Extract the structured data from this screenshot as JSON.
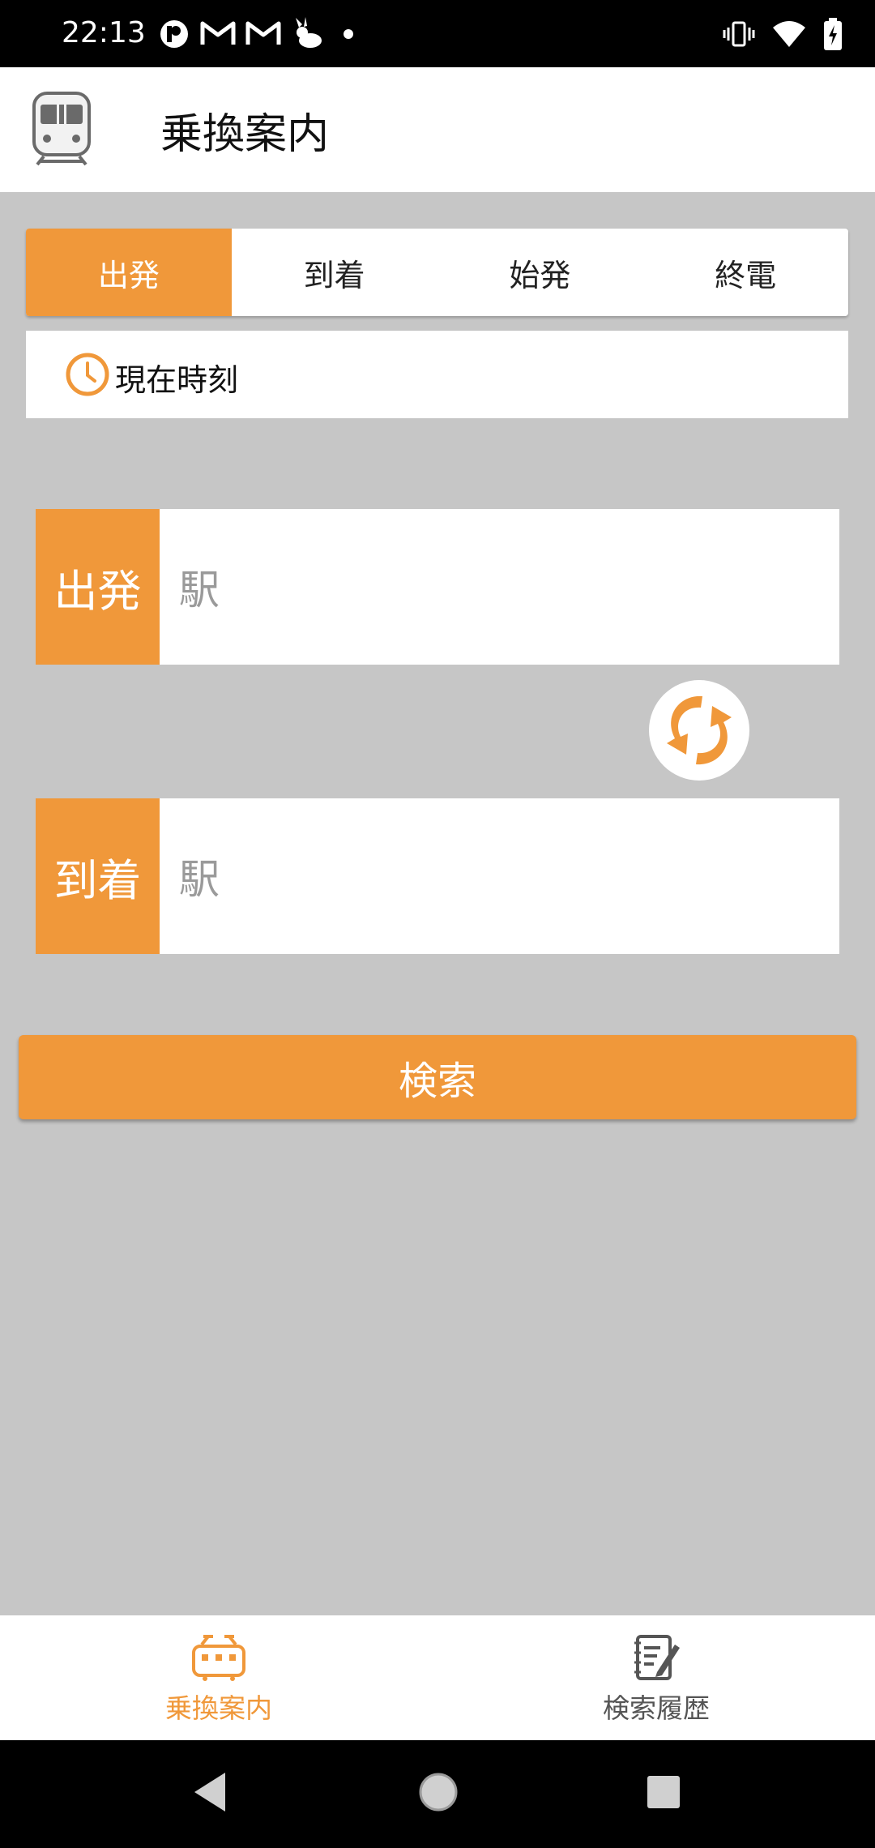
{
  "status_bar": {
    "time": "22:13",
    "left_icons": [
      "notification-app-icon",
      "gmail-icon",
      "gmail-icon",
      "rabbit-app-icon",
      "more-dot-icon"
    ],
    "right_icons": [
      "vibrate-icon",
      "wifi-icon",
      "battery-charging-icon"
    ]
  },
  "app_bar": {
    "title": "乗換案内",
    "logo_icon": "train-icon"
  },
  "tabs": [
    {
      "label": "出発",
      "active": true
    },
    {
      "label": "到着",
      "active": false
    },
    {
      "label": "始発",
      "active": false
    },
    {
      "label": "終電",
      "active": false
    }
  ],
  "time_selector": {
    "icon": "clock-icon",
    "label": "現在時刻"
  },
  "departure": {
    "tag": "出発",
    "placeholder": "駅"
  },
  "arrival": {
    "tag": "到着",
    "placeholder": "駅"
  },
  "swap_button": {
    "icon": "swap-icon"
  },
  "search_button": {
    "label": "検索"
  },
  "bottom_nav": [
    {
      "label": "乗換案内",
      "icon": "train-icon",
      "active": true
    },
    {
      "label": "検索履歴",
      "icon": "history-icon",
      "active": false
    }
  ],
  "system_nav": [
    "back-icon",
    "home-icon",
    "recents-icon"
  ],
  "colors": {
    "accent": "#f0983a",
    "background": "#c6c6c6",
    "placeholder": "#9a9a9a"
  }
}
